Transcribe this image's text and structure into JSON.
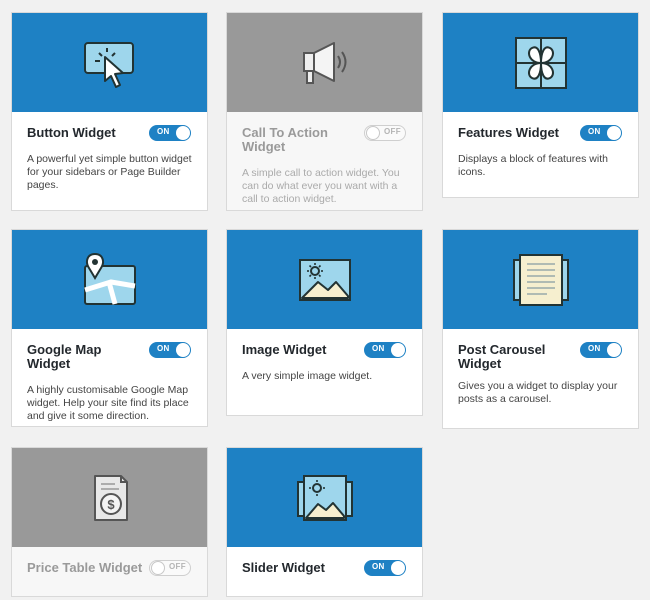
{
  "colors": {
    "accent": "#1e81c4",
    "disabled": "#999999"
  },
  "widgets": [
    {
      "title": "Button Widget",
      "enabled": true,
      "toggle": "ON",
      "icon": "cursor-click-icon",
      "description": "A powerful yet simple button widget for your sidebars or Page Builder pages."
    },
    {
      "title": "Call To Action Widget",
      "enabled": false,
      "toggle": "OFF",
      "icon": "megaphone-icon",
      "description": "A simple call to action widget. You can do what ever you want with a call to action widget."
    },
    {
      "title": "Features Widget",
      "enabled": true,
      "toggle": "ON",
      "icon": "features-grid-icon",
      "description": "Displays a block of features with icons."
    },
    {
      "title": "Google Map Widget",
      "enabled": true,
      "toggle": "ON",
      "icon": "map-pin-icon",
      "description": "A highly customisable Google Map widget. Help your site find its place and give it some direction."
    },
    {
      "title": "Image Widget",
      "enabled": true,
      "toggle": "ON",
      "icon": "image-icon",
      "description": "A very simple image widget."
    },
    {
      "title": "Post Carousel Widget",
      "enabled": true,
      "toggle": "ON",
      "icon": "carousel-icon",
      "description": "Gives you a widget to display your posts as a carousel."
    },
    {
      "title": "Price Table Widget",
      "enabled": false,
      "toggle": "OFF",
      "icon": "price-tag-icon",
      "description": ""
    },
    {
      "title": "Slider Widget",
      "enabled": true,
      "toggle": "ON",
      "icon": "slider-icon",
      "description": ""
    }
  ]
}
